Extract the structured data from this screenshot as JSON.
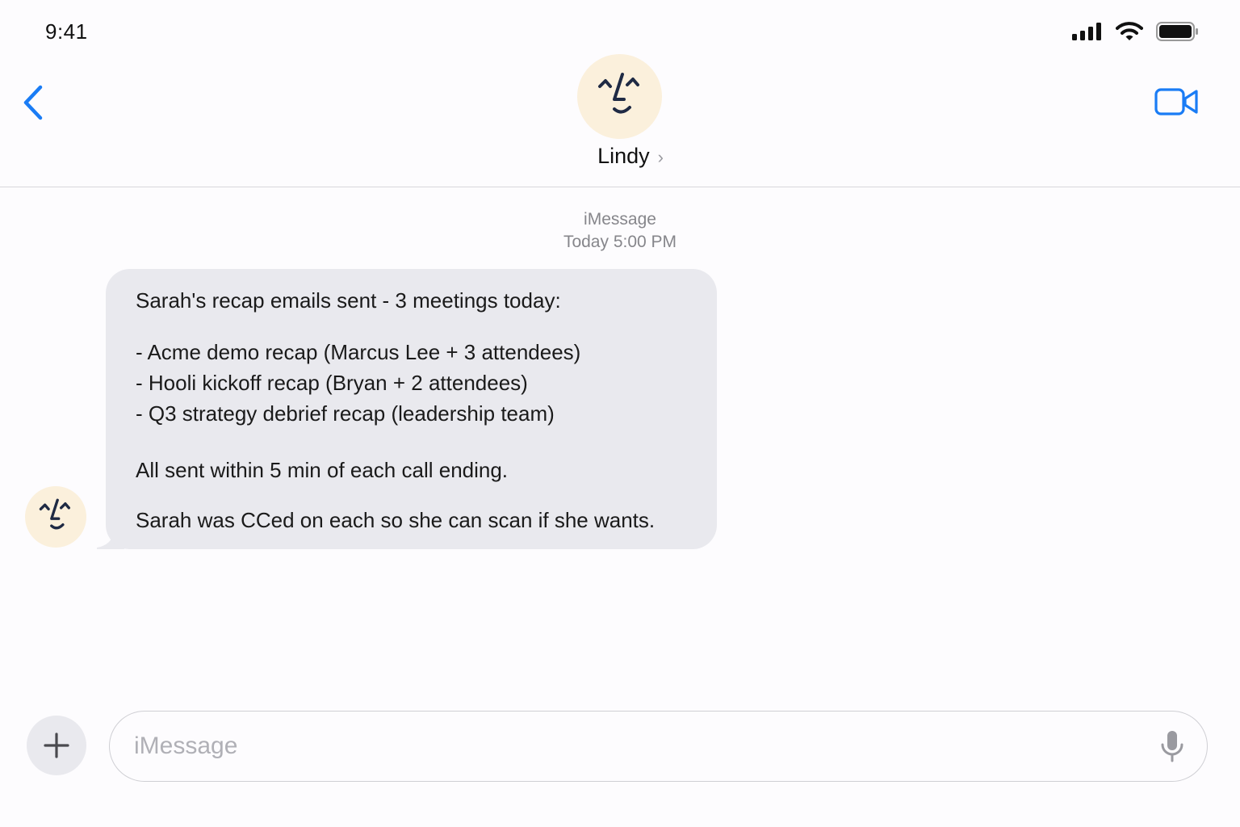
{
  "status_bar": {
    "time": "9:41"
  },
  "header": {
    "contact_name": "Lindy",
    "chevron": "›"
  },
  "thread": {
    "service": "iMessage",
    "timestamp": "Today 5:00 PM"
  },
  "message": {
    "intro": "Sarah's recap emails sent - 3 meetings today:",
    "items": [
      "- Acme demo recap (Marcus Lee + 3 attendees)",
      "- Hooli kickoff recap (Bryan + 2 attendees)",
      "- Q3 strategy debrief recap (leadership team)"
    ],
    "line_sent": "All sent within 5 min of each call ending.",
    "line_cc": "Sarah was CCed on each so she can scan if she wants."
  },
  "composer": {
    "placeholder": "iMessage",
    "value": ""
  },
  "colors": {
    "accent": "#1a7cf5",
    "bubble": "#e9e9ee",
    "avatar_bg": "#fbf0dc",
    "avatar_ink": "#1f2a44"
  },
  "icons": [
    "back-chevron-icon",
    "video-call-icon",
    "signal-icon",
    "wifi-icon",
    "battery-icon",
    "plus-icon",
    "microphone-icon",
    "lindy-face-icon"
  ]
}
